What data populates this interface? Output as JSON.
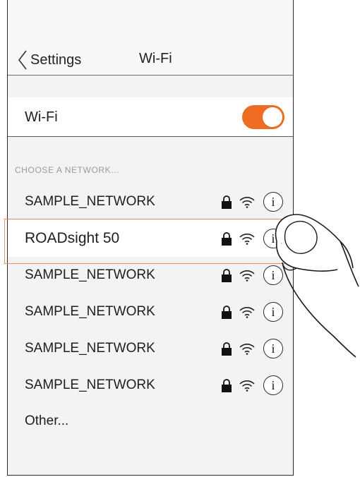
{
  "navbar": {
    "back_label": "Settings",
    "title": "Wi-Fi"
  },
  "wifi_toggle": {
    "label": "Wi-Fi",
    "state": "on",
    "accent_color": "#ed6c22"
  },
  "networks_section": {
    "header": "CHOOSE A NETWORK...",
    "items": [
      {
        "name": "SAMPLE_NETWORK",
        "secured": true,
        "icons": [
          "lock-icon",
          "wifi-signal-icon",
          "info-icon"
        ]
      },
      {
        "name": "ROADsight 50",
        "secured": true,
        "selected": true,
        "icons": [
          "lock-icon",
          "wifi-signal-icon",
          "info-icon"
        ]
      },
      {
        "name": "SAMPLE_NETWORK",
        "secured": true,
        "icons": [
          "lock-icon",
          "wifi-signal-icon",
          "info-icon"
        ]
      },
      {
        "name": "SAMPLE_NETWORK",
        "secured": true,
        "icons": [
          "lock-icon",
          "wifi-signal-icon",
          "info-icon"
        ]
      },
      {
        "name": "SAMPLE_NETWORK",
        "secured": true,
        "icons": [
          "lock-icon",
          "wifi-signal-icon",
          "info-icon"
        ]
      },
      {
        "name": "SAMPLE_NETWORK",
        "secured": true,
        "icons": [
          "lock-icon",
          "wifi-signal-icon",
          "info-icon"
        ]
      }
    ],
    "other_label": "Other...",
    "info_glyph": "i"
  },
  "highlight_color": "#e8905a"
}
